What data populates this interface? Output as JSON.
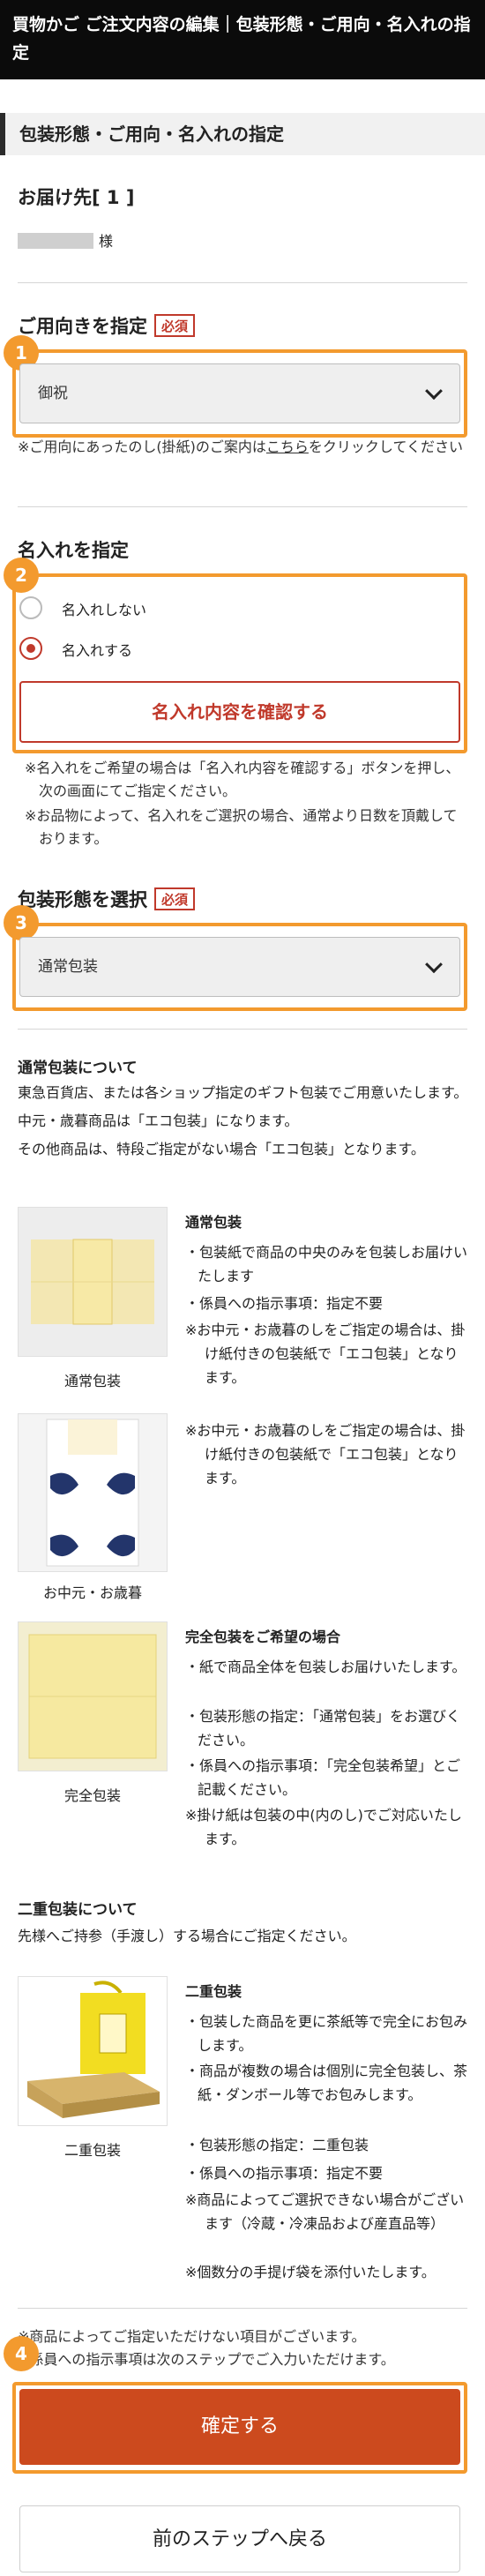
{
  "header": {
    "title": "買物かご ご注文内容の編集｜包装形態・ご用向・名入れの指定"
  },
  "subheader": {
    "title": "包装形態・ご用向・名入れの指定"
  },
  "delivery": {
    "heading": "お届け先[ 1 ]",
    "recipient_suffix": "様"
  },
  "usage": {
    "heading": "ご用向きを指定",
    "required": "必須",
    "badge": "1",
    "selected": "御祝",
    "note_prefix": "※ご用向にあったのし(掛紙)のご案内は",
    "note_link": "こちら",
    "note_suffix": "をクリックしてください"
  },
  "naire": {
    "heading": "名入れを指定",
    "badge": "2",
    "options": [
      "名入れしない",
      "名入れする"
    ],
    "selected_index": 1,
    "confirm_button": "名入れ内容を確認する",
    "notes": [
      "※名入れをご希望の場合は「名入れ内容を確認する」ボタンを押し、次の画面にてご指定ください。",
      "※お品物によって、名入れをご選択の場合、通常より日数を頂戴しております。"
    ]
  },
  "packaging": {
    "heading": "包装形態を選択",
    "required": "必須",
    "badge": "3",
    "selected": "通常包装"
  },
  "about_normal": {
    "title": "通常包装について",
    "lines": [
      "東急百貨店、または各ショップ指定のギフト包装でご用意いたします。",
      "中元・歳暮商品は「エコ包装」になります。",
      "その他商品は、特段ご指定がない場合「エコ包装」となります。"
    ]
  },
  "pack_items": [
    {
      "caption": "通常包装",
      "title": "通常包装",
      "bullets": [
        "・包装紙で商品の中央のみを包装しお届けいたします",
        "・係員への指示事項：指定不要",
        "※お中元・お歳暮のしをご指定の場合は、掛け紙付きの包装紙で「エコ包装」となります。"
      ]
    },
    {
      "caption": "お中元・お歳暮",
      "title": "",
      "bullets": [
        "※お中元・お歳暮のしをご指定の場合は、掛け紙付きの包装紙で「エコ包装」となります。"
      ]
    },
    {
      "caption": "完全包装",
      "title": "完全包装をご希望の場合",
      "bullets": [
        "・紙で商品全体を包装しお届けいたします。",
        "・包装形態の指定：「通常包装」をお選びください。",
        "・係員への指示事項：「完全包装希望」とご記載ください。",
        "※掛け紙は包装の中(内のし)でご対応いたします。"
      ]
    }
  ],
  "about_double": {
    "title": "二重包装について",
    "line": "先様へご持参（手渡し）する場合にご指定ください。",
    "caption": "二重包装",
    "item_title": "二重包装",
    "bullets": [
      "・包装した商品を更に茶紙等で完全にお包みします。",
      "・商品が複数の場合は個別に完全包装し、茶紙・ダンボール等でお包みします。",
      "・包装形態の指定：二重包装",
      "・係員への指示事項：指定不要",
      "※商品によってご選択できない場合がございます（冷蔵・冷凍品および産直品等）",
      "※個数分の手提げ袋を添付いたします。"
    ]
  },
  "footer_notes": [
    "※商品によってご指定いただけない項目がございます。",
    "※係員への指示事項は次のステップでご入力いただけます。"
  ],
  "actions": {
    "badge": "4",
    "confirm": "確定する",
    "back": "前のステップへ戻る"
  },
  "colors": {
    "accent_orange": "#f39a2e",
    "brand_red": "#c0392b",
    "primary_button": "#cc4a1e",
    "header_bg": "#0b0b0b"
  }
}
